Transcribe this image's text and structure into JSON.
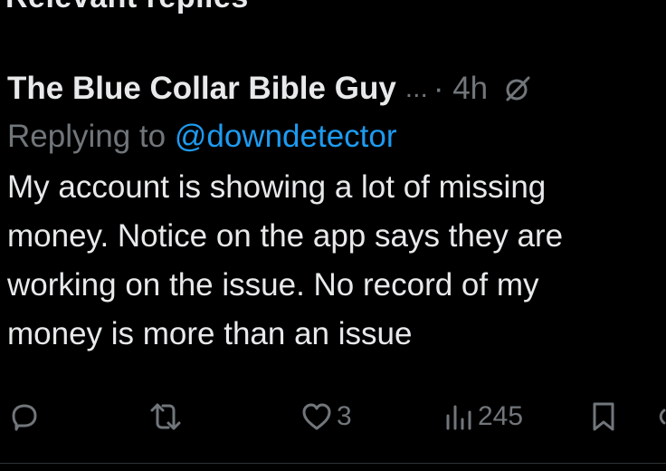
{
  "top_cut_text": "Relevant replies",
  "tweet": {
    "author_name": "The Blue Collar Bible Guy",
    "ellipsis": "...",
    "time": "· 4h",
    "reply_label": "Replying to",
    "reply_handle": "@downdetector",
    "body_lines": [
      "My account is showing a lot of missing",
      "money. Notice on the app says they are",
      "working on the issue. No record of my",
      "money is more than an issue"
    ]
  },
  "actions": {
    "reply_icon": "reply-icon",
    "retweet_icon": "retweet-icon",
    "like_icon": "heart-icon",
    "likes": "3",
    "views_icon": "views-icon",
    "views": "245",
    "bookmark_icon": "bookmark-icon"
  },
  "colors": {
    "background": "#000000",
    "text": "#e7e9ea",
    "muted": "#71767b",
    "link": "#1d9bf0"
  }
}
